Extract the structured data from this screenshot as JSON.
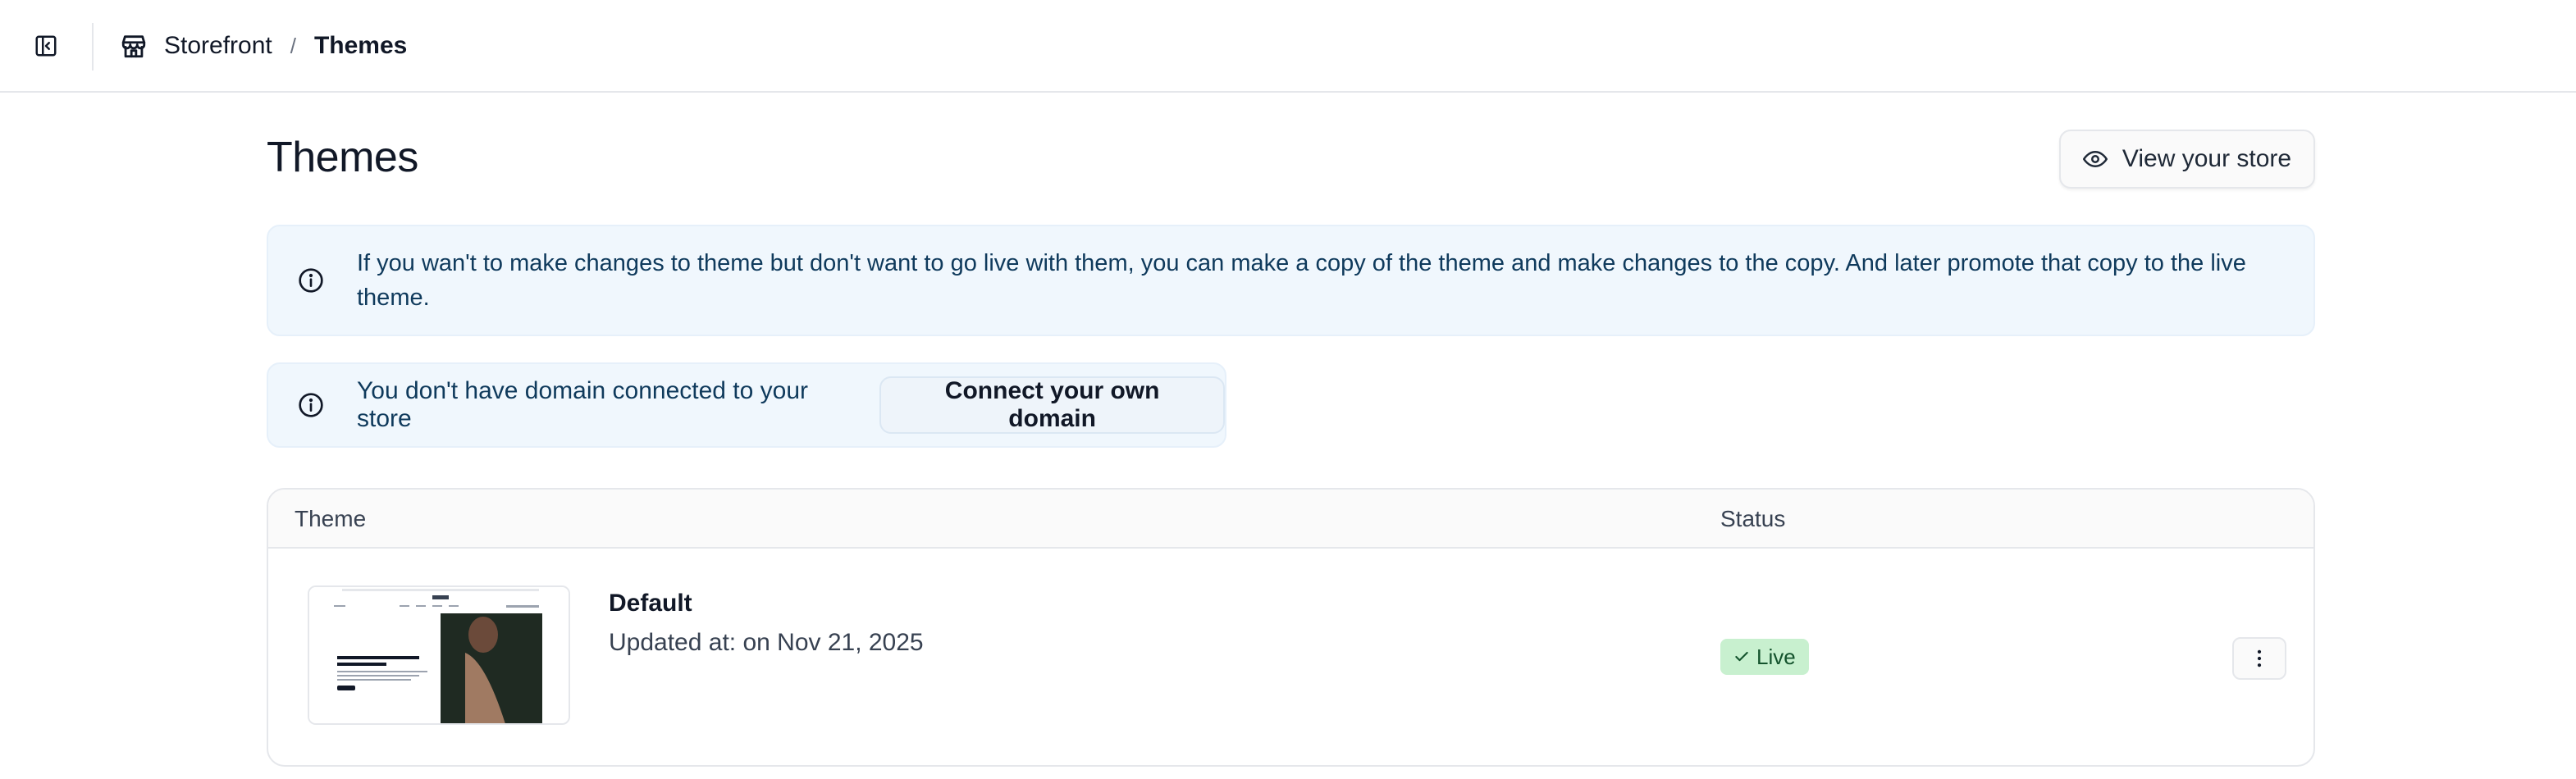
{
  "breadcrumb": {
    "store_icon": "storefront-icon",
    "root": "Storefront",
    "separator": "/",
    "current": "Themes"
  },
  "sidebar_toggle_icon": "sidebar-toggle-icon",
  "page": {
    "title": "Themes",
    "view_store_label": "View your store",
    "view_store_icon": "eye-icon"
  },
  "info_banner": {
    "icon": "info-icon",
    "text": "If you wan't to make changes to theme but don't want to go live with them, you can make a copy of the theme and make changes to the copy. And later promote that copy to the live theme."
  },
  "domain_banner": {
    "icon": "info-icon",
    "text": "You don't have domain connected to your store",
    "button_label": "Connect your own domain"
  },
  "table": {
    "columns": [
      "Theme",
      "Status"
    ],
    "rows": [
      {
        "name": "Default",
        "updated": "Updated at: on Nov 21, 2025",
        "status": "Live",
        "status_icon": "check-icon",
        "menu_icon": "more-vertical-icon"
      }
    ]
  },
  "colors": {
    "banner_bg": "#f0f7fd",
    "banner_text": "#0f3a5c",
    "live_badge_bg": "#c8f0cf",
    "live_badge_text": "#14532d"
  }
}
